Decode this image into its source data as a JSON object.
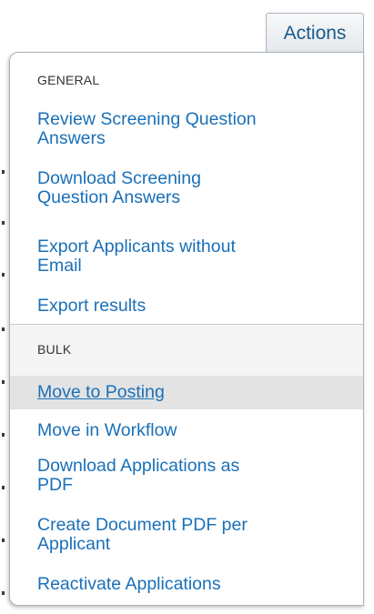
{
  "toolbar": {
    "actions_label": "Actions"
  },
  "menu": {
    "general_heading": "GENERAL",
    "general_items": [
      {
        "line1": "Review Screening Question",
        "line2": "Answers"
      },
      {
        "line1": "Download Screening",
        "line2": "Question Answers"
      },
      {
        "line1": "Export Applicants without",
        "line2": "Email"
      },
      {
        "line1": "Export results",
        "line2": ""
      }
    ],
    "bulk_heading": "BULK",
    "bulk_items": [
      {
        "line1": "Move to Posting",
        "line2": "",
        "hovered": true
      },
      {
        "line1": "Move in Workflow",
        "line2": ""
      },
      {
        "line1": "Download Applications as",
        "line2": "PDF"
      },
      {
        "line1": "Create Document PDF per",
        "line2": "Applicant"
      },
      {
        "line1": "Reactivate Applications",
        "line2": ""
      }
    ]
  },
  "colors": {
    "link": "#1a70b8",
    "hover_background": "#e3e3e3",
    "border": "#a9b3bd"
  }
}
